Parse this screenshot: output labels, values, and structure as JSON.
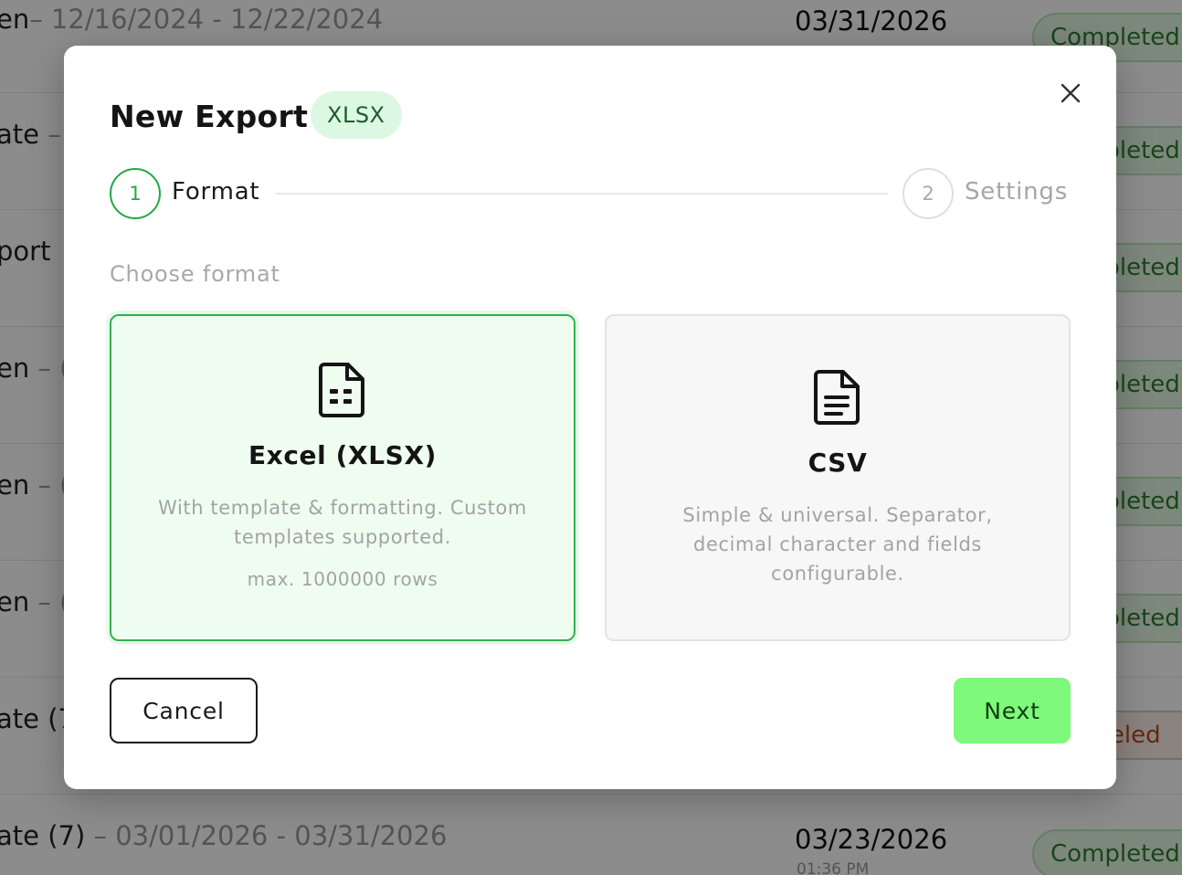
{
  "background": {
    "rows": [
      {
        "name": "en",
        "dates": "– 12/16/2024 - 12/22/2024",
        "date": "03/31/2026",
        "time": "",
        "status": "Completed"
      },
      {
        "name": "ate",
        "dates": " –",
        "date": "",
        "time": "",
        "status": "Completed"
      },
      {
        "name": "port",
        "dates": "",
        "date": "",
        "time": "",
        "status": "Completed"
      },
      {
        "name": "en",
        "dates": " – (",
        "date": "",
        "time": "",
        "status": "Completed"
      },
      {
        "name": "en",
        "dates": " – (",
        "date": "",
        "time": "",
        "status": "Completed"
      },
      {
        "name": "en",
        "dates": " – (",
        "date": "",
        "time": "",
        "status": "Completed"
      },
      {
        "name": "ate (7",
        "dates": "",
        "date": "",
        "time": "",
        "status": "Canceled"
      },
      {
        "name": "ate (7)",
        "dates": " – 03/01/2026 - 03/31/2026",
        "date": "03/23/2026",
        "time": "01:36 PM",
        "status": "Completed"
      }
    ]
  },
  "modal": {
    "title": "New Export",
    "badge": "XLSX",
    "close_icon": "close-icon",
    "steps": [
      {
        "number": "1",
        "label": "Format",
        "active": true
      },
      {
        "number": "2",
        "label": "Settings",
        "active": false
      }
    ],
    "section_label": "Choose format",
    "formats": [
      {
        "icon": "spreadsheet-file-icon",
        "title": "Excel (XLSX)",
        "description": "With template & formatting. Custom templates supported.",
        "limit": "max. 1000000 rows",
        "selected": true
      },
      {
        "icon": "text-file-icon",
        "title": "CSV",
        "description": "Simple & universal. Separator, decimal character and fields configurable.",
        "limit": "",
        "selected": false
      }
    ],
    "cancel_label": "Cancel",
    "next_label": "Next"
  },
  "colors": {
    "accent_green": "#22a846",
    "next_button": "#7ef97b",
    "selected_card_bg": "#effdf1"
  }
}
